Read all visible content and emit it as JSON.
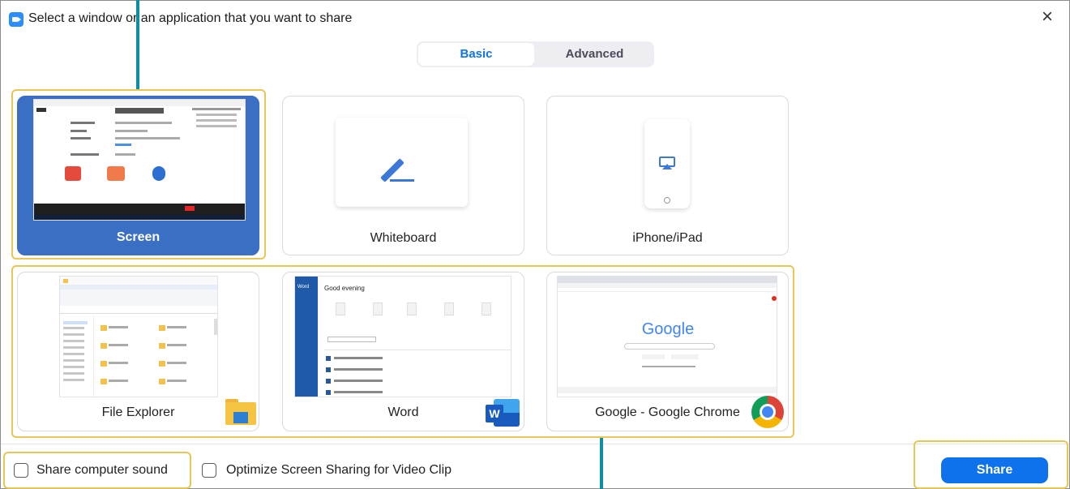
{
  "window": {
    "title": "Select a window or an application that you want to share"
  },
  "tabs": [
    {
      "label": "Basic"
    },
    {
      "label": "Advanced"
    }
  ],
  "basic_tiles": [
    {
      "label": "Screen"
    },
    {
      "label": "Whiteboard"
    },
    {
      "label": "iPhone/iPad"
    }
  ],
  "app_tiles": [
    {
      "label": "File Explorer"
    },
    {
      "label": "Word"
    },
    {
      "label": "Google - Google Chrome"
    }
  ],
  "options": {
    "share_sound": "Share computer sound",
    "optimize_video": "Optimize Screen Sharing for Video Clip"
  },
  "share_button": "Share",
  "thumbnails": {
    "word_app": "Word",
    "word_greeting": "Good evening",
    "google_logo": "Google"
  },
  "colors": {
    "accent": "#0e72ed",
    "selected_tile": "#3b6fc4",
    "highlight": "#e7c557",
    "pointer": "#0f8ea0"
  },
  "icons": [
    "zoom-logo-icon",
    "close-icon",
    "pen-icon",
    "airplay-icon",
    "folder-icon",
    "word-icon",
    "chrome-icon"
  ]
}
